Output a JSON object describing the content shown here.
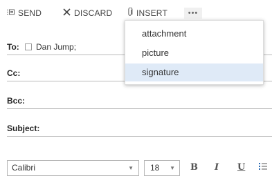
{
  "toolbar": {
    "send_label": "SEND",
    "discard_label": "DISCARD",
    "insert_label": "INSERT",
    "more_label": "•••",
    "send_icon": "send-icon",
    "discard_icon": "close-x-icon",
    "insert_icon": "paperclip-icon"
  },
  "insert_menu": {
    "items": [
      {
        "label": "attachment"
      },
      {
        "label": "picture"
      },
      {
        "label": "signature",
        "highlighted": true
      }
    ],
    "highlight_color": "#dfeaf7"
  },
  "fields": {
    "to_label": "To:",
    "to_recipient": "Dan Jump;",
    "cc_label": "Cc:",
    "bcc_label": "Bcc:",
    "subject_label": "Subject:"
  },
  "format_bar": {
    "font_name": "Calibri",
    "font_size": "18",
    "bold_label": "B",
    "italic_label": "I",
    "underline_label": "U",
    "bullets_icon": "bullet-list-icon"
  }
}
